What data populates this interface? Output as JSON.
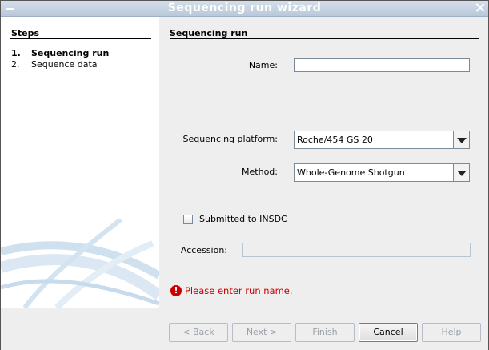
{
  "window": {
    "title": "Sequencing run wizard"
  },
  "steps_panel": {
    "heading": "Steps",
    "steps": [
      {
        "num": "1.",
        "label": "Sequencing run",
        "active": true
      },
      {
        "num": "2.",
        "label": "Sequence data",
        "active": false
      }
    ]
  },
  "form": {
    "heading": "Sequencing run",
    "name": {
      "label": "Name:",
      "value": ""
    },
    "platform": {
      "label": "Sequencing platform:",
      "value": "Roche/454 GS 20"
    },
    "method": {
      "label": "Method:",
      "value": "Whole-Genome Shotgun"
    },
    "insdc": {
      "label": "Submitted to INSDC",
      "checked": false
    },
    "accession": {
      "label": "Accession:",
      "value": ""
    },
    "error": {
      "icon": "error-icon",
      "message": "Please enter run name."
    }
  },
  "buttons": {
    "back": "< Back",
    "next": "Next >",
    "finish": "Finish",
    "cancel": "Cancel",
    "help": "Help"
  }
}
